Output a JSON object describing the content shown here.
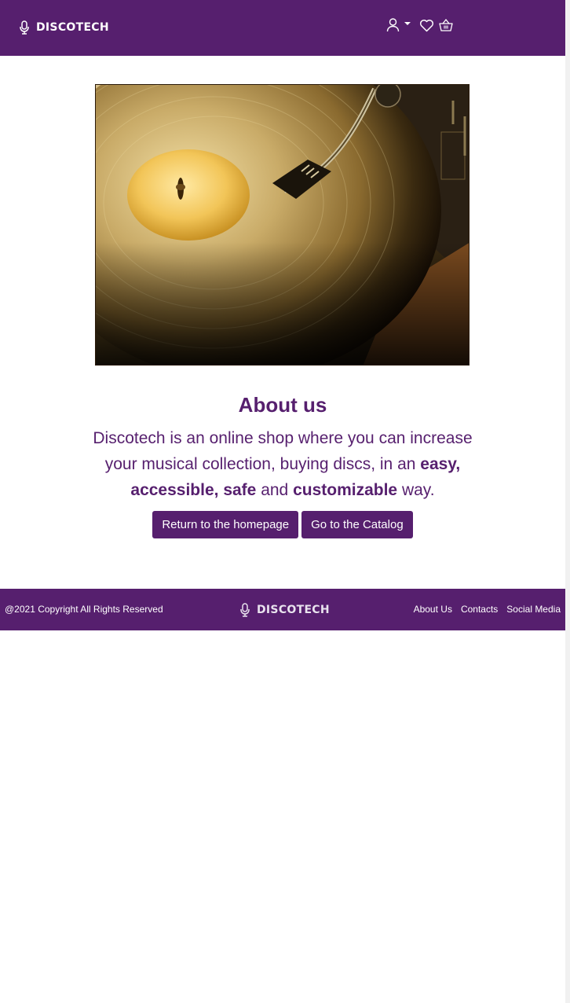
{
  "header": {
    "brand": "DISCOTECH",
    "icons": [
      "microphone-icon",
      "user-icon",
      "heart-icon",
      "basket-icon"
    ]
  },
  "hero": {
    "image": "vinyl-record-turntable"
  },
  "about": {
    "title": "About us",
    "text_1": "Discotech is an online shop where you can increase your musical collection, buying discs, in an ",
    "bold_easy": "easy,",
    "text_2": " ",
    "bold_accessible": "accessible,",
    "text_3": " ",
    "bold_safe": "safe",
    "text_4": " and ",
    "bold_customizable": "customizable",
    "text_5": " way."
  },
  "buttons": {
    "homepage": "Return to the homepage",
    "catalog": "Go to the Catalog"
  },
  "footer": {
    "copyright": "@2021 Copyright All Rights Reserved",
    "brand": "DISCOTECH",
    "links": [
      "About Us",
      "Contacts",
      "Social Media"
    ]
  },
  "colors": {
    "primary": "#561f6e",
    "text_on_primary": "#ffffff",
    "background": "#ffffff"
  }
}
